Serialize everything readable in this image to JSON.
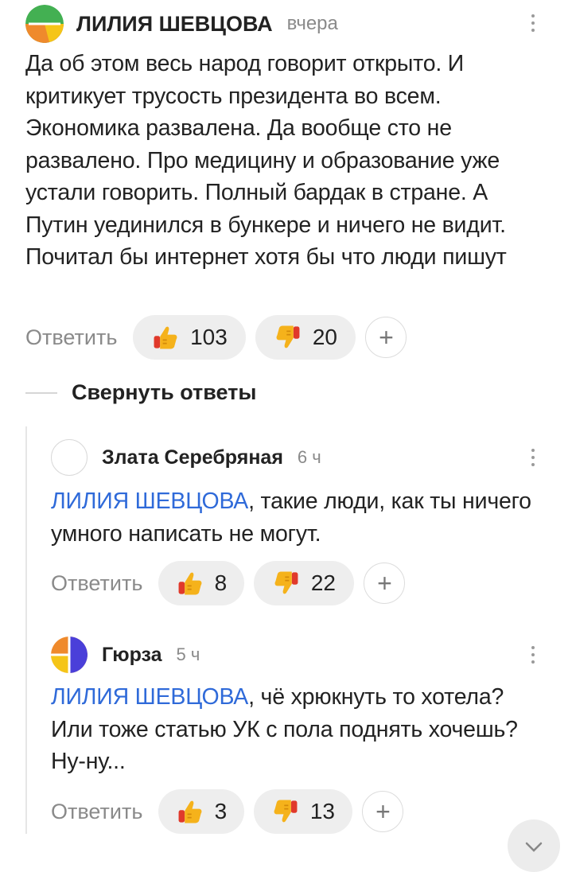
{
  "comments": [
    {
      "author": "ЛИЛИЯ ШЕВЦОВА",
      "time": "вчера",
      "text": "Да об этом весь народ говорит открыто. И критикует трусость президента во всем. Экономика развалена. Да вообще сто не развалено. Про медицину и образование уже устали говорить. Полный бардак в стране. А Путин уединился в бункере и ничего не видит. Почитал бы интернет хотя бы что люди пишут",
      "reply_label": "Ответить",
      "likes": "103",
      "dislikes": "20",
      "plus": "+"
    }
  ],
  "collapse_label": "Свернуть ответы",
  "replies": [
    {
      "author": "Злата Серебряная",
      "time": "6 ч",
      "mention": "ЛИЛИЯ ШЕВЦОВА",
      "text": ", такие люди, как ты ничего умного написать не могут.",
      "reply_label": "Ответить",
      "likes": "8",
      "dislikes": "22",
      "plus": "+"
    },
    {
      "author": "Гюрза",
      "time": "5 ч",
      "mention": "ЛИЛИЯ ШЕВЦОВА",
      "text": ", чё хрюкнуть то хотела? Или тоже статью УК с пола поднять хочешь? Ну-ну...",
      "reply_label": "Ответить",
      "likes": "3",
      "dislikes": "13",
      "plus": "+"
    }
  ],
  "colors": {
    "mention": "#2f6ad9",
    "pill_bg": "#eeeeee",
    "thumb_up": "#f5b21b",
    "thumb_down": "#f5b21b",
    "cuff": "#e0392b"
  },
  "icons": {
    "like": "thumbs-up-icon",
    "dislike": "thumbs-down-icon",
    "more": "more-vertical-icon",
    "scroll": "chevron-down-icon"
  }
}
